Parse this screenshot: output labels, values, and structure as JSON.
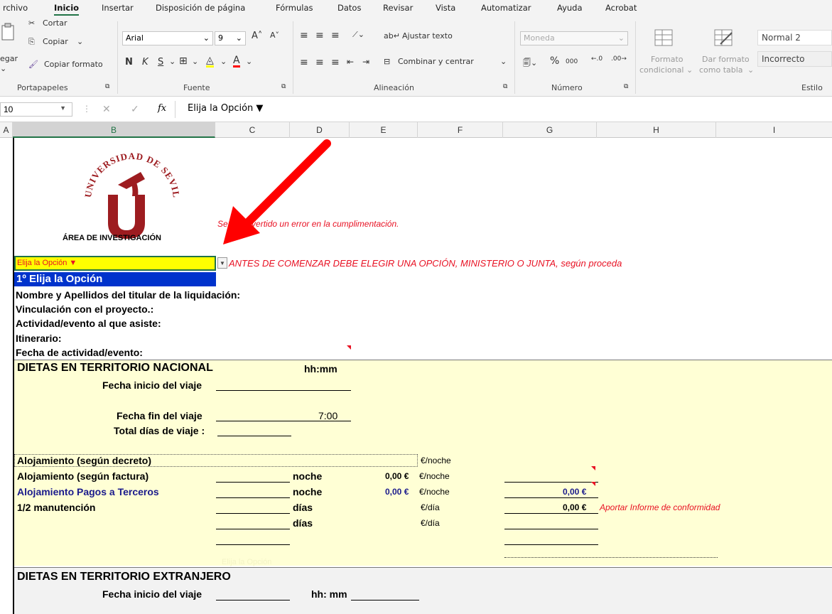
{
  "menubar": {
    "items": [
      "rchivo",
      "Inicio",
      "Insertar",
      "Disposición de página",
      "Fórmulas",
      "Datos",
      "Revisar",
      "Vista",
      "Automatizar",
      "Ayuda",
      "Acrobat"
    ]
  },
  "ribbon": {
    "clipboard": {
      "paste": "egar",
      "cut": "Cortar",
      "copy": "Copiar",
      "copy_format": "Copiar formato",
      "group": "Portapapeles"
    },
    "font": {
      "name": "Arial",
      "size": "9",
      "bold": "N",
      "italic": "K",
      "underline": "S",
      "group": "Fuente"
    },
    "alignment": {
      "wrap": "Ajustar texto",
      "merge": "Combinar y centrar",
      "group": "Alineación"
    },
    "number": {
      "format": "Moneda",
      "percent": "%",
      "thousands": "000",
      "group": "Número"
    },
    "styles": {
      "cond_format_1": "Formato",
      "cond_format_2": "condicional",
      "table_format_1": "Dar formato",
      "table_format_2": "como tabla",
      "style_normal": "Normal 2",
      "style_bad": "Incorrecto",
      "group": "Estilo"
    }
  },
  "formula_bar": {
    "name_box": "10",
    "fx": "fx",
    "content": "Elija la Opción  ▼"
  },
  "columns": [
    "A",
    "B",
    "C",
    "D",
    "E",
    "F",
    "G",
    "H",
    "I"
  ],
  "sheet": {
    "logo": {
      "arc": "UNIVERSIDAD DE SEVILLA",
      "letter": "u",
      "area": "ÁREA DE INVESTIGACIÓN"
    },
    "error_note": "Se ha advertido un error en la cumplimentación.",
    "dropdown_cell": "Elija la Opción  ▼",
    "dropdown_option": "1º Elija la Opción",
    "instruction": "ANTES DE COMENZAR DEBE ELEGIR UNA OPCIÓN, MINISTERIO O JUNTA, según proceda",
    "fields": {
      "titular": "Nombre y Apellidos del titular de la liquidación:",
      "vinculacion": "Vinculación con el proyecto.:",
      "actividad": "Actividad/evento al que asiste:",
      "itinerario": "Itinerario:",
      "fecha": "Fecha de actividad/evento:"
    },
    "nacional": {
      "title": "DIETAS EN TERRITORIO NACIONAL",
      "hhmm": "hh:mm",
      "inicio": "Fecha inicio del viaje",
      "fin": "Fecha fin del viaje",
      "fin_time": "7:00",
      "total": "Total días de viaje :",
      "aloj_decreto": "Alojamiento (según decreto)",
      "aloj_decreto_unit": "€/noche",
      "aloj_factura": "Alojamiento (según factura)",
      "aloj_factura_unit": "noche",
      "aloj_factura_amount": "0,00 €",
      "aloj_factura_per": "€/noche",
      "aloj_terceros": "Alojamiento Pagos a Terceros",
      "aloj_terceros_unit": "noche",
      "aloj_terceros_amount": "0,00 €",
      "aloj_terceros_per": "€/noche",
      "aloj_terceros_total": "0,00 €",
      "manutencion": "1/2 manutención",
      "manut_unit": "días",
      "manut_per": "€/día",
      "manut_total": "0,00 €",
      "manut_note": "Aportar Informe de conformidad",
      "row2_unit": "días",
      "row2_per": "€/día",
      "faint_text": "Elija la Opción"
    },
    "extranjero": {
      "title": "DIETAS EN TERRITORIO EXTRANJERO",
      "inicio": "Fecha inicio del viaje",
      "hhmm": "hh: mm"
    }
  }
}
